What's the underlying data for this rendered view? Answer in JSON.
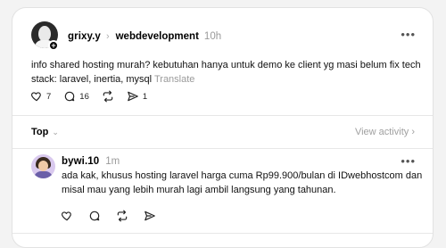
{
  "post": {
    "username": "grixy.y",
    "community": "webdevelopment",
    "time": "10h",
    "text": "info shared hosting murah? kebutuhan hanya untuk demo ke client yg masi belum fix tech stack: laravel, inertia, mysql",
    "translate_label": "Translate",
    "actions": {
      "like_count": "7",
      "comment_count": "16",
      "share_count": "1"
    }
  },
  "sort_bar": {
    "sort_label": "Top",
    "view_activity_label": "View activity",
    "view_activity_chevron": "›"
  },
  "reply": {
    "username": "bywi.10",
    "time": "1m",
    "text": "ada kak, khusus hosting laravel harga cuma Rp99.900/bulan di IDwebhostcom dan misal mau yang lebih murah lagi ambil langsung yang tahunan."
  },
  "icons": {
    "more": "•••",
    "chevron_right": "›",
    "chevron_down": "⌄",
    "plus": "+"
  }
}
